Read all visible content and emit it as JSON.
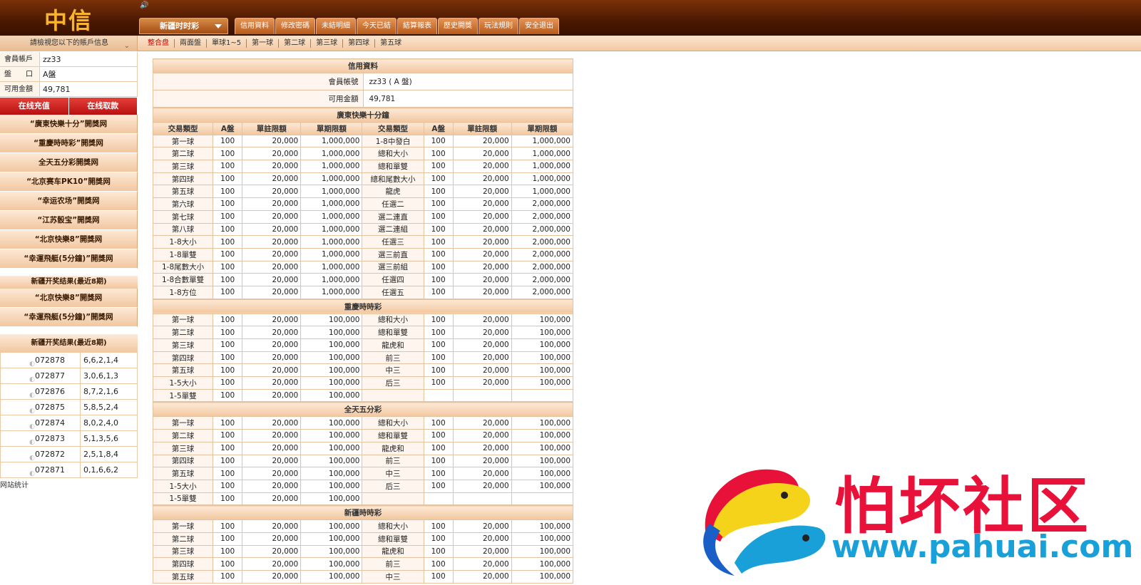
{
  "header": {
    "logo": "中信",
    "game_select": "新疆时时彩",
    "nav": [
      "信用資料",
      "修改密碼",
      "未結明細",
      "今天已結",
      "結算報表",
      "歷史開獎",
      "玩法規則",
      "安全退出"
    ]
  },
  "subbar": {
    "account_header": "請檢視您以下的賬戶信息",
    "tabs": [
      "整合盘",
      "兩面盤",
      "單球1~5",
      "第一球",
      "第二球",
      "第三球",
      "第四球",
      "第五球"
    ]
  },
  "sidebar": {
    "account": [
      {
        "label": "會員帳戶",
        "value": "zz33"
      },
      {
        "label": "盤　　口",
        "value": "A盤"
      },
      {
        "label": "可用金額",
        "value": "49,781"
      }
    ],
    "buttons": [
      "在线充值",
      "在线取款"
    ],
    "lottery_links": [
      "“廣東快樂十分”開獎网",
      "“重慶時時彩”開獎网",
      "全天五分彩開獎网",
      "“北京赛车PK10”開獎网",
      "“幸运农场”開獎网",
      "“江苏骰宝”開獎网",
      "“北京快樂8”開獎网",
      "“幸運飛艇(5分鐘)”開獎网"
    ],
    "section1_title": "新疆开奖结果(最近8期)",
    "lottery_links2": [
      "“北京快樂8”開獎网",
      "“幸運飛艇(5分鐘)”開獎网"
    ],
    "section2_title": "新疆开奖结果(最近8期)",
    "results": [
      {
        "issue": "072878",
        "nums": "6,6,2,1,4"
      },
      {
        "issue": "072877",
        "nums": "3,0,6,1,3"
      },
      {
        "issue": "072876",
        "nums": "8,7,2,1,6"
      },
      {
        "issue": "072875",
        "nums": "5,8,5,2,4"
      },
      {
        "issue": "072874",
        "nums": "8,0,2,4,0"
      },
      {
        "issue": "072873",
        "nums": "5,1,3,5,6"
      },
      {
        "issue": "072872",
        "nums": "2,5,1,8,4"
      },
      {
        "issue": "072871",
        "nums": "0,1,6,6,2"
      }
    ],
    "stats": "网站统计"
  },
  "main": {
    "credit_title": "信用資料",
    "member_label": "會員帳號",
    "member_value": "zz33 ( A 盤)",
    "balance_label": "可用金額",
    "balance_value": "49,781",
    "col_headers": [
      "交易類型",
      "A盤",
      "單註限額",
      "單期限額",
      "交易類型",
      "A盤",
      "單註限額",
      "單期限額"
    ],
    "sections": [
      {
        "title": "廣東快樂十分鐘",
        "show_header": true,
        "rows": [
          [
            "第一球",
            "100",
            "20,000",
            "1,000,000",
            "1-8中發白",
            "100",
            "20,000",
            "1,000,000"
          ],
          [
            "第二球",
            "100",
            "20,000",
            "1,000,000",
            "總和大小",
            "100",
            "20,000",
            "1,000,000"
          ],
          [
            "第三球",
            "100",
            "20,000",
            "1,000,000",
            "總和單雙",
            "100",
            "20,000",
            "1,000,000"
          ],
          [
            "第四球",
            "100",
            "20,000",
            "1,000,000",
            "總和尾數大小",
            "100",
            "20,000",
            "1,000,000"
          ],
          [
            "第五球",
            "100",
            "20,000",
            "1,000,000",
            "龍虎",
            "100",
            "20,000",
            "1,000,000"
          ],
          [
            "第六球",
            "100",
            "20,000",
            "1,000,000",
            "任選二",
            "100",
            "20,000",
            "2,000,000"
          ],
          [
            "第七球",
            "100",
            "20,000",
            "1,000,000",
            "選二連直",
            "100",
            "20,000",
            "2,000,000"
          ],
          [
            "第八球",
            "100",
            "20,000",
            "1,000,000",
            "選二連組",
            "100",
            "20,000",
            "2,000,000"
          ],
          [
            "1-8大小",
            "100",
            "20,000",
            "1,000,000",
            "任選三",
            "100",
            "20,000",
            "2,000,000"
          ],
          [
            "1-8單雙",
            "100",
            "20,000",
            "1,000,000",
            "選三前直",
            "100",
            "20,000",
            "2,000,000"
          ],
          [
            "1-8尾數大小",
            "100",
            "20,000",
            "1,000,000",
            "選三前組",
            "100",
            "20,000",
            "2,000,000"
          ],
          [
            "1-8合數單雙",
            "100",
            "20,000",
            "1,000,000",
            "任選四",
            "100",
            "20,000",
            "2,000,000"
          ],
          [
            "1-8方位",
            "100",
            "20,000",
            "1,000,000",
            "任選五",
            "100",
            "20,000",
            "2,000,000"
          ]
        ]
      },
      {
        "title": "重慶時時彩",
        "show_header": false,
        "rows": [
          [
            "第一球",
            "100",
            "20,000",
            "100,000",
            "總和大小",
            "100",
            "20,000",
            "100,000"
          ],
          [
            "第二球",
            "100",
            "20,000",
            "100,000",
            "總和單雙",
            "100",
            "20,000",
            "100,000"
          ],
          [
            "第三球",
            "100",
            "20,000",
            "100,000",
            "龍虎和",
            "100",
            "20,000",
            "100,000"
          ],
          [
            "第四球",
            "100",
            "20,000",
            "100,000",
            "前三",
            "100",
            "20,000",
            "100,000"
          ],
          [
            "第五球",
            "100",
            "20,000",
            "100,000",
            "中三",
            "100",
            "20,000",
            "100,000"
          ],
          [
            "1-5大小",
            "100",
            "20,000",
            "100,000",
            "后三",
            "100",
            "20,000",
            "100,000"
          ],
          [
            "1-5單雙",
            "100",
            "20,000",
            "100,000",
            "",
            "",
            "",
            ""
          ]
        ]
      },
      {
        "title": "全天五分彩",
        "show_header": false,
        "rows": [
          [
            "第一球",
            "100",
            "20,000",
            "100,000",
            "總和大小",
            "100",
            "20,000",
            "100,000"
          ],
          [
            "第二球",
            "100",
            "20,000",
            "100,000",
            "總和單雙",
            "100",
            "20,000",
            "100,000"
          ],
          [
            "第三球",
            "100",
            "20,000",
            "100,000",
            "龍虎和",
            "100",
            "20,000",
            "100,000"
          ],
          [
            "第四球",
            "100",
            "20,000",
            "100,000",
            "前三",
            "100",
            "20,000",
            "100,000"
          ],
          [
            "第五球",
            "100",
            "20,000",
            "100,000",
            "中三",
            "100",
            "20,000",
            "100,000"
          ],
          [
            "1-5大小",
            "100",
            "20,000",
            "100,000",
            "后三",
            "100",
            "20,000",
            "100,000"
          ],
          [
            "1-5單雙",
            "100",
            "20,000",
            "100,000",
            "",
            "",
            "",
            ""
          ]
        ]
      },
      {
        "title": "新疆時時彩",
        "show_header": false,
        "rows": [
          [
            "第一球",
            "100",
            "20,000",
            "100,000",
            "總和大小",
            "100",
            "20,000",
            "100,000"
          ],
          [
            "第二球",
            "100",
            "20,000",
            "100,000",
            "總和單雙",
            "100",
            "20,000",
            "100,000"
          ],
          [
            "第三球",
            "100",
            "20,000",
            "100,000",
            "龍虎和",
            "100",
            "20,000",
            "100,000"
          ],
          [
            "第四球",
            "100",
            "20,000",
            "100,000",
            "前三",
            "100",
            "20,000",
            "100,000"
          ],
          [
            "第五球",
            "100",
            "20,000",
            "100,000",
            "中三",
            "100",
            "20,000",
            "100,000"
          ]
        ]
      }
    ]
  },
  "watermark": {
    "text": "怕坏社区",
    "url": "www.pahuai.com",
    "colors": {
      "red": "#e8113a",
      "blue": "#1aa0d8",
      "yellow": "#f5d31a"
    }
  }
}
